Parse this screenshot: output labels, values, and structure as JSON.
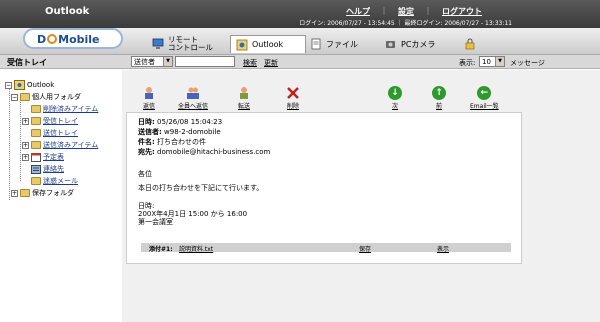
{
  "header": {
    "app_title": "Outlook",
    "help": "ヘルプ",
    "settings": "設定",
    "logout": "ログアウト",
    "login_info": "ログイン: 2006/07/27 - 13:54:45 ｜ 最終ログイン: 2006/07/27 - 13:33:11"
  },
  "logo": {
    "pre": "D",
    "post": "Mobile"
  },
  "tabs": {
    "remote_line1": "リモート",
    "remote_line2": "コントロール",
    "outlook": "Outlook",
    "file": "ファイル",
    "pc_camera": "PCカメラ"
  },
  "toolbar": {
    "inbox_label": "受信トレイ",
    "filter_value": "送信者",
    "search": "検索",
    "refresh": "更新",
    "display_label": "表示:",
    "display_count": "10",
    "messages_label": "メッセージ"
  },
  "tree": {
    "root": "Outlook",
    "personal": "個人用フォルダ",
    "deleted": "削除済みアイテム",
    "inbox": "受信トレイ",
    "outbox": "送信トレイ",
    "sent": "送信済みアイテム",
    "calendar": "予定表",
    "contacts": "連絡先",
    "junk": "迷惑メール",
    "archive": "保存フォルダ"
  },
  "actions": {
    "reply": "返信",
    "reply_all": "全員へ返信",
    "forward": "転送",
    "delete": "削除",
    "next": "次",
    "prev": "前",
    "email_list": "Email一覧"
  },
  "message": {
    "date_label": "日時:",
    "date_value": "05/26/08 15:04:23",
    "from_label": "送信者:",
    "from_value": "w98-2-domobile",
    "subject_label": "件名:",
    "subject_value": "打ち合わせの件",
    "to_label": "宛先:",
    "to_value": "domobile@hitachi-business.com",
    "body_greeting": "各位",
    "body_line1": "本日の打ち合わせを下記にて行います。",
    "body_when_label": "日時:",
    "body_when": "200X年4月1日 15:00 から 16:00",
    "body_where": "第一会議室",
    "attachment_label": "添付#1:",
    "attachment_name": "説明資料.txt",
    "attachment_save": "保存",
    "attachment_view": "表示"
  },
  "colors": {
    "header_bg": "#4a4a4a",
    "link_blue": "#1c3c8c",
    "nav_green": "#2e9a2e",
    "logo_blue": "#1e4d8c",
    "logo_orange": "#e08a1e"
  }
}
